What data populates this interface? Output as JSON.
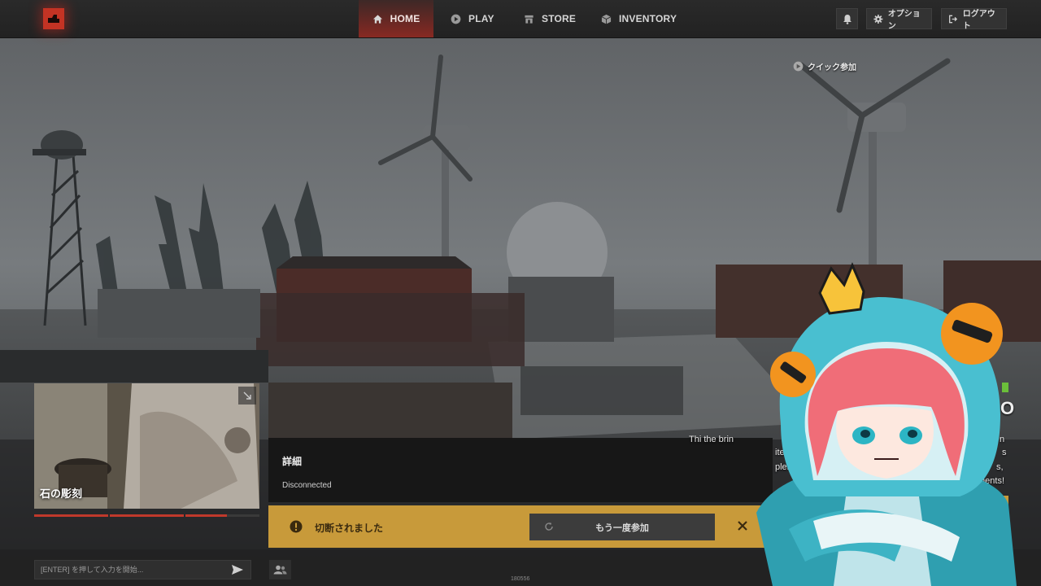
{
  "nav": {
    "tabs": [
      {
        "label": "HOME",
        "icon": "home-icon",
        "active": true
      },
      {
        "label": "PLAY",
        "icon": "play-icon",
        "active": false
      },
      {
        "label": "STORE",
        "icon": "store-icon",
        "active": false
      },
      {
        "label": "INVENTORY",
        "icon": "inventory-icon",
        "active": false
      }
    ],
    "options_label": "オプション",
    "logout_label": "ログアウト",
    "quick_join_label": "クイック参加"
  },
  "video": {
    "caption": "石の彫刻",
    "progress": [
      1.0,
      1.0,
      0.56,
      0.0
    ]
  },
  "details": {
    "title": "詳細",
    "status": "Disconnected"
  },
  "alert": {
    "message": "切断されました",
    "rejoin_label": "もう一度参加"
  },
  "news": {
    "line1": "Thi                the brin",
    "line2": "ite Cra",
    "line3": "plenty of b",
    "line4": "ments!",
    "s_letter": "s",
    "s2_letter": "s,",
    "n_letter": "n",
    "btn_label": "む",
    "heading_letter": "O"
  },
  "chat": {
    "placeholder": "[ENTER] を押して入力を開始..."
  },
  "build": "180556",
  "colors": {
    "accent_red": "#c33324",
    "alert_yellow": "#c89a3a",
    "panel_dark": "#161616"
  }
}
